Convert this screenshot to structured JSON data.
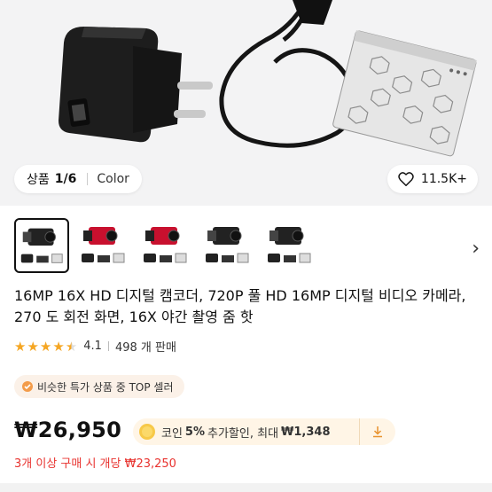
{
  "gallery": {
    "counter_label": "상품",
    "counter_value": "1/6",
    "color_label": "Color",
    "likes": "11.5K+"
  },
  "thumbnails": [
    {
      "variant": "black",
      "selected": true
    },
    {
      "variant": "red",
      "selected": false
    },
    {
      "variant": "red",
      "selected": false
    },
    {
      "variant": "black",
      "selected": false
    },
    {
      "variant": "black",
      "selected": false
    }
  ],
  "product": {
    "title": "16MP 16X HD 디지털 캠코더, 720P 풀 HD 16MP 디지털 비디오 카메라, 270 도 회전 화면, 16X 야간 촬영 줌 핫",
    "rating": "4.1",
    "sold": "498 개 판매",
    "badge": "비슷한 특가 상품 중 TOP 셀러",
    "price": "₩26,950",
    "coin_prefix": "코인",
    "coin_percent": "5%",
    "coin_mid": "추가할인, 최대",
    "coin_max": "₩1,348",
    "bulk_offer": "3개 이상 구매 시 개당 ₩23,250"
  },
  "colors": {
    "accent_red": "#e8322e",
    "star": "#f5a623",
    "coin_bg": "#fff5e6"
  }
}
